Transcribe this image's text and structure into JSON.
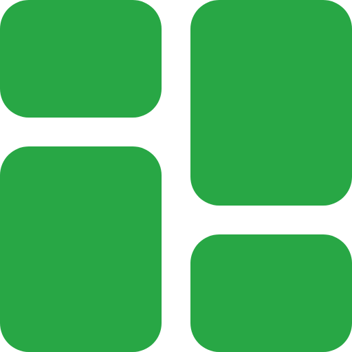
{
  "icon": {
    "name": "dashboard-layout-icon",
    "color": "#28a745",
    "background": "#ffffff"
  }
}
